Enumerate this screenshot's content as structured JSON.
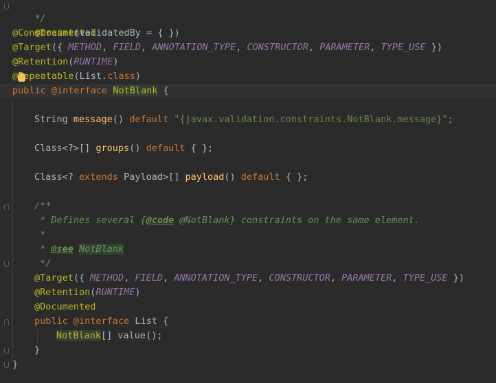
{
  "editor": {
    "lines": {
      "l1": "*/",
      "l2": "@Documented",
      "l3_ann": "@Constraint",
      "l3_rest": "(validatedBy = { })",
      "l4_ann": "@Target",
      "l4_open": "({ ",
      "l4_c1": "METHOD",
      "l4_c2": "FIELD",
      "l4_c3": "ANNOTATION_TYPE",
      "l4_c4": "CONSTRUCTOR",
      "l4_c5": "PARAMETER",
      "l4_c6": "TYPE_USE",
      "l4_close": " })",
      "sep": ", ",
      "l5_ann": "@Retention",
      "l5_c": "RUNTIME",
      "l6_ann": "@Repeatable",
      "l6_rest": "(List.",
      "l6_kw": "class",
      "l6_end": ")",
      "l7_kw": "public @interface ",
      "l7_name": "NotBlank",
      "l7_end": " {",
      "l9_type": "String ",
      "l9_fn": "message",
      "l9_paren": "() ",
      "l9_kw": "default",
      "l9_str": "\"{javax.validation.constraints.NotBlank.message}\"",
      "l9_end": ";",
      "l11_type": "Class<?>[] ",
      "l11_fn": "groups",
      "l11_paren": "() ",
      "l11_kw": "default",
      "l11_end": " { };",
      "l13_type1": "Class<? ",
      "l13_kw1": "extends",
      "l13_type2": " Payload>[] ",
      "l13_fn": "payload",
      "l13_paren": "() ",
      "l13_kw2": "default",
      "l13_end": " { };",
      "l15": "/**",
      "l16_pre": " * Defines several {",
      "l16_tag": "@code",
      "l16_post": " @NotBlank} constraints on the same element.",
      "l17": " *",
      "l18_pre": " * ",
      "l18_tag": "@see",
      "l18_ref": "NotBlank",
      "l19": " */",
      "l20_ann": "@Target",
      "l21_ann": "@Retention",
      "l22": "@Documented",
      "l23_kw": "public @interface ",
      "l23_name": "List {",
      "l24_ref": "NotBlank",
      "l24_rest": "[] ",
      "l24_fn": "value",
      "l24_end": "();",
      "l25": "}",
      "l26": "}"
    }
  },
  "colors": {
    "background": "#2b2b2b",
    "annotation": "#bbb529",
    "keyword": "#cc7832",
    "constant": "#9876aa",
    "string": "#6a8759",
    "method": "#ffc66d",
    "doc": "#629755"
  },
  "icons": {
    "intention": "lightbulb-icon"
  }
}
